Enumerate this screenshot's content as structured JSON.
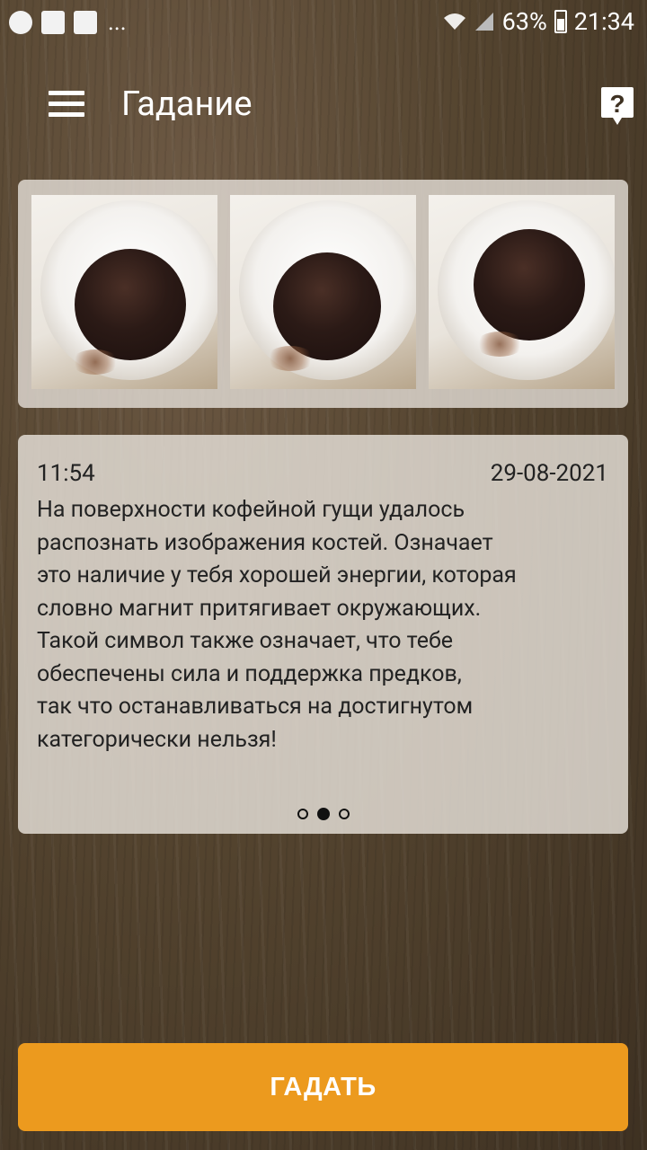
{
  "status_bar": {
    "notification_icons": [
      "whatsapp-icon",
      "gmail-icon",
      "image-icon"
    ],
    "overflow": "...",
    "battery": "63%",
    "time": "21:34"
  },
  "toolbar": {
    "title": "Гадание",
    "menu_icon": "hamburger-menu-icon",
    "help_icon": "help-question-icon"
  },
  "gallery": {
    "images": [
      "coffee-cup-photo-1",
      "coffee-cup-photo-2",
      "coffee-cup-photo-3"
    ]
  },
  "reading": {
    "time": "11:54",
    "date": "29-08-2021",
    "text": "На поверхности кофейной гущи удалось\nраспознать изображения костей. Означает\nэто наличие у тебя хорошей энергии, которая\nсловно магнит притягивает окружающих.\nТакой символ также означает, что тебе\nобеспечены сила и поддержка предков,\nтак что останавливаться на достигнутом\nкатегорически нельзя!",
    "pager": {
      "pages": 3,
      "current": 2
    }
  },
  "action_button": {
    "label": "ГАДАТЬ",
    "color": "#ec9a1e"
  }
}
